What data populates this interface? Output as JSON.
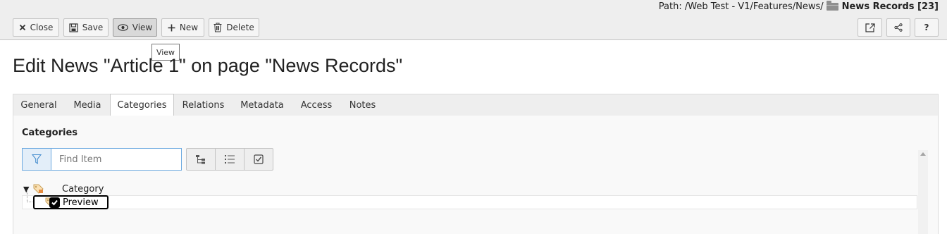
{
  "header": {
    "path_label": "Path: /Web Test - V1/Features/News/",
    "page_name": "News Records [23]"
  },
  "toolbar": {
    "close_label": "Close",
    "save_label": "Save",
    "view_label": "View",
    "new_label": "New",
    "delete_label": "Delete",
    "view_tooltip": "View"
  },
  "page": {
    "title": "Edit News \"Article 1\" on page \"News Records\""
  },
  "tabs": [
    {
      "label": "General"
    },
    {
      "label": "Media"
    },
    {
      "label": "Categories"
    },
    {
      "label": "Relations"
    },
    {
      "label": "Metadata"
    },
    {
      "label": "Access"
    },
    {
      "label": "Notes"
    }
  ],
  "categories": {
    "section_label": "Categories",
    "filter_placeholder": "Find Item",
    "tree_root": "Category",
    "tree_child": "Preview",
    "tree_child_checked": true
  },
  "colors": {
    "accent": "#6daae0",
    "toolbar_bg": "#eeeeee"
  }
}
